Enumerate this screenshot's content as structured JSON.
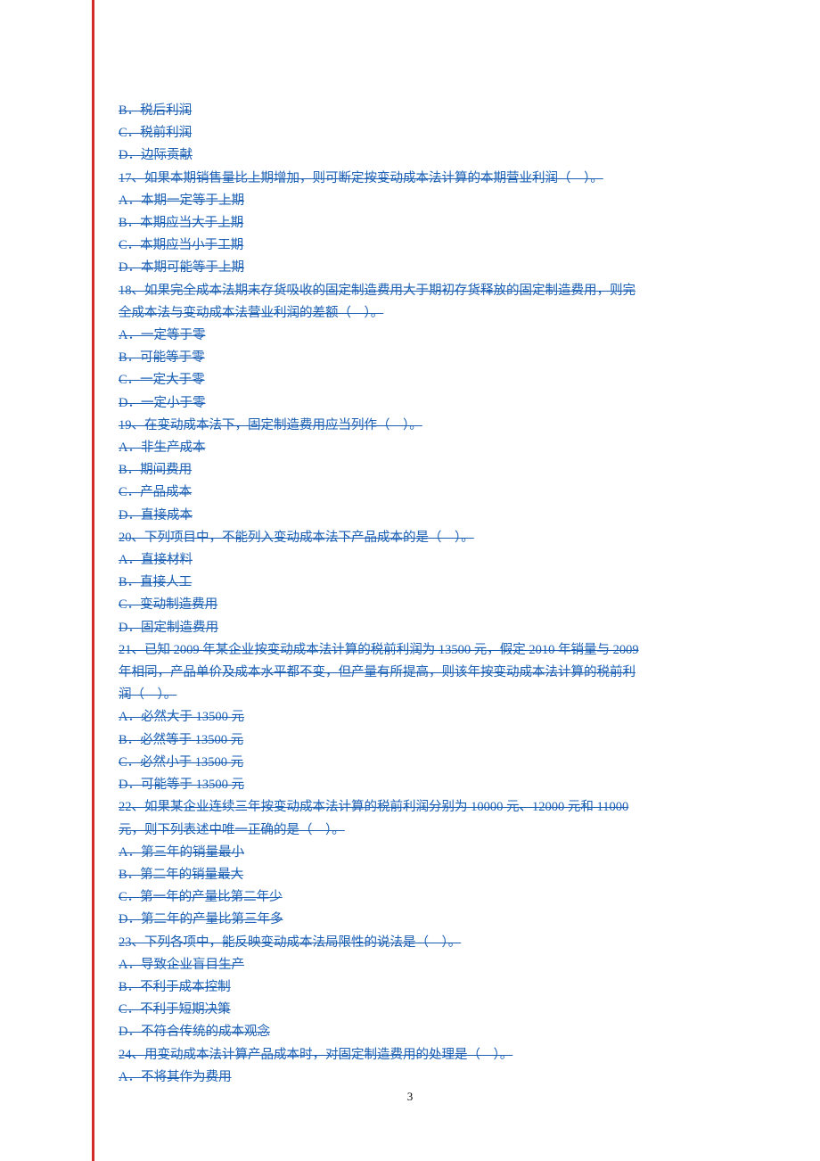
{
  "lines": [
    "B．税后利润",
    "C．税前利润",
    "D．边际贡献",
    "17、如果本期销售量比上期增加，则可断定按变动成本法计算的本期营业利润（　）。",
    "A．本期一定等于上期",
    "B．本期应当大于上期",
    "C．本期应当小于工期",
    "D．本期可能等于上期",
    "18、如果完全成本法期末存货吸收的固定制造费用大于期初存货释放的固定制造费用，则完",
    "全成本法与变动成本法营业利润的差额（　）。",
    "A．一定等于零",
    "B．可能等于零",
    "C．一定大于零",
    "D．一定小于零",
    "19、在变动成本法下，固定制造费用应当列作（　）。",
    "A．非生产成本",
    "B．期间费用",
    "C．产品成本",
    "D．直接成本",
    "20、下列项目中，不能列入变动成本法下产品成本的是（　）。",
    "A．直接材料",
    "B．直接人工",
    "C．变动制造费用",
    "D．固定制造费用",
    "21、已知 2009 年某企业按变动成本法计算的税前利润为 13500 元，假定 2010 年销量与 2009",
    "年相同，产品单价及成本水平都不变，但产量有所提高，则该年按变动成本法计算的税前利",
    "润（　）。",
    "A．必然大于 13500 元",
    "B．必然等于 13500 元",
    "C．必然小于 13500 元",
    "D．可能等于 13500 元",
    "22、如果某企业连续三年按变动成本法计算的税前利润分别为 10000 元、12000 元和 11000",
    "元，则下列表述中唯一正确的是（　）。",
    "A．第三年的销量最小",
    "B．第二年的销量最大",
    "C．第一年的产量比第二年少",
    "D．第二年的产量比第三年多",
    "23、下列各项中，能反映变动成本法局限性的说法是（　）。",
    "A．导致企业盲目生产",
    "B．不利于成本控制",
    "C．不利于短期决策",
    "D．不符合传统的成本观念",
    "24、用变动成本法计算产品成本时，对固定制造费用的处理是（　）。",
    "A．不将其作为费用"
  ],
  "pageNumber": "3"
}
